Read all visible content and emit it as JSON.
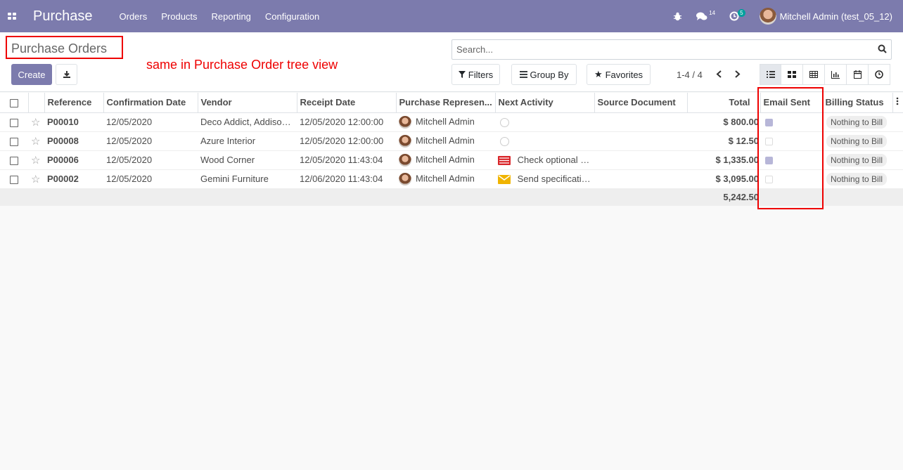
{
  "navbar": {
    "app_title": "Purchase",
    "menu": [
      "Orders",
      "Products",
      "Reporting",
      "Configuration"
    ],
    "messages_count": "14",
    "activities_count": "5",
    "user": "Mitchell Admin (test_05_12)"
  },
  "control": {
    "title": "Purchase Orders",
    "annotation": "same in Purchase Order tree view",
    "create_label": "Create",
    "search_placeholder": "Search...",
    "filters_label": "Filters",
    "groupby_label": "Group By",
    "favorites_label": "Favorites",
    "pager": "1-4 / 4"
  },
  "table": {
    "headers": [
      "Reference",
      "Confirmation Date",
      "Vendor",
      "Receipt Date",
      "Purchase Represen...",
      "Next Activity",
      "Source Document",
      "Total",
      "Email Sent",
      "Billing Status"
    ],
    "rows": [
      {
        "ref": "P00010",
        "conf": "12/05/2020",
        "vendor": "Deco Addict, Addiso…",
        "receipt": "12/05/2020 12:00:00",
        "rep": "Mitchell Admin",
        "activity": "",
        "activity_icon": "clock-icon",
        "source": "",
        "total": "$ 800.00",
        "email_sent": true,
        "billing": "Nothing to Bill"
      },
      {
        "ref": "P00008",
        "conf": "12/05/2020",
        "vendor": "Azure Interior",
        "receipt": "12/05/2020 12:00:00",
        "rep": "Mitchell Admin",
        "activity": "",
        "activity_icon": "clock-icon",
        "source": "",
        "total": "$ 12.50",
        "email_sent": false,
        "billing": "Nothing to Bill"
      },
      {
        "ref": "P00006",
        "conf": "12/05/2020",
        "vendor": "Wood Corner",
        "receipt": "12/05/2020 11:43:04",
        "rep": "Mitchell Admin",
        "activity": "Check optional p…",
        "activity_icon": "list-icon",
        "source": "",
        "total": "$ 1,335.00",
        "email_sent": true,
        "billing": "Nothing to Bill"
      },
      {
        "ref": "P00002",
        "conf": "12/05/2020",
        "vendor": "Gemini Furniture",
        "receipt": "12/06/2020 11:43:04",
        "rep": "Mitchell Admin",
        "activity": "Send specificati…",
        "activity_icon": "envelope-icon",
        "source": "",
        "total": "$ 3,095.00",
        "email_sent": false,
        "billing": "Nothing to Bill"
      }
    ],
    "footer_total": "5,242.50"
  },
  "colors": {
    "brand": "#7c7bad",
    "annotation": "#ee0000"
  }
}
